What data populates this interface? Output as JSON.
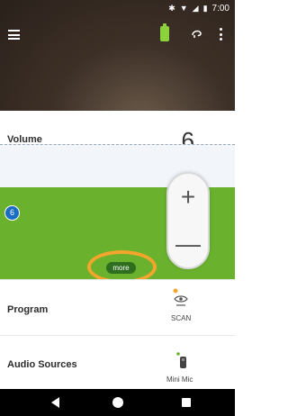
{
  "status": {
    "time": "7:00",
    "icons": [
      "bluetooth-icon",
      "wifi-icon",
      "cellular-icon",
      "battery-icon"
    ]
  },
  "header": {
    "icons": [
      "menu-icon",
      "battery-full-icon",
      "hearing-aid-icon",
      "more-vert-icon"
    ]
  },
  "volume": {
    "label": "Volume",
    "value": "6",
    "badge_value": "6",
    "more_label": "more",
    "stepper": {
      "plus": "+",
      "minus": "—"
    }
  },
  "program": {
    "label": "Program",
    "value": "SCAN"
  },
  "audio_sources": {
    "label": "Audio Sources",
    "value": "Mini Mic"
  },
  "colors": {
    "accent_green": "#6ab22e",
    "badge_blue": "#1a6dc0",
    "highlight_orange": "#f4a52b"
  },
  "navbar": {
    "icons": [
      "back-icon",
      "home-icon",
      "recents-icon"
    ]
  }
}
